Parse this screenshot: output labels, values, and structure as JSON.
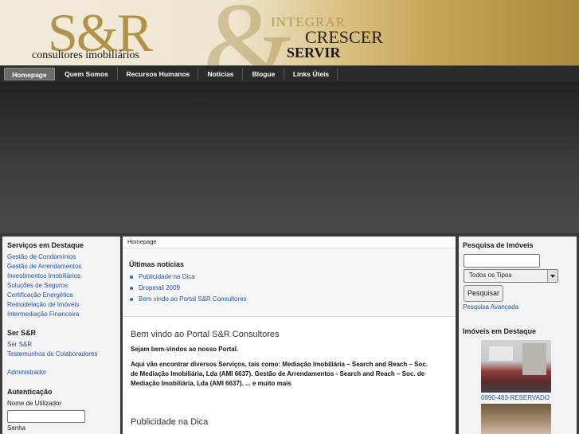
{
  "header": {
    "logo_initials": "S&R",
    "logo_subtitle": "consultores imobiliários",
    "slogan": [
      "INTEGRAR",
      "CRESCER",
      "SERVIR"
    ]
  },
  "nav": [
    "Homepage",
    "Quem Somos",
    "Recursos Humanos",
    "Notícias",
    "Blogue",
    "Links Úteis"
  ],
  "left": {
    "servicos_title": "Serviços em Destaque",
    "servicos": [
      "Gestão de Condomínios",
      "Gestão de Arrendamentos",
      "Investimentos Imobiliários",
      "Soluções de Seguros",
      "Certificação Energética",
      "Remodelação de Imóveis",
      "Intermediação Financeira"
    ],
    "ser_title": "Ser S&R",
    "ser_links": [
      "Ser S&R",
      "Testemunhos de Colaboradores"
    ],
    "admin": "Administrador",
    "auth_title": "Autenticação",
    "user_label": "Nome de Utilizador",
    "pass_label": "Senha"
  },
  "main": {
    "breadcrumb": "Homepage",
    "news_title": "Últimas notícias",
    "news": [
      "Publicidade na Dica",
      "Dropmail 2009",
      "Bem vindo ao Portal S&R Consultores"
    ],
    "article_title": "Bem vindo ao Portal S&R Consultores",
    "article_lead": "Sejam bem-vindos ao nosso Portal.",
    "article_body": [
      "Aqui vão encontrar diversos Serviços, tais como: Mediação Imobiliária – Search and Reach – Soc.",
      "de Mediação Imobiliária, Lda (AMI 6637). Gestão de Arrendamentos - Search and Reach – Soc. de",
      "Mediação Imobiliária, Lda (AMI 6637). ... e muito mais"
    ],
    "article2_title": "Publicidade na Dica"
  },
  "right": {
    "search_title": "Pesquisa de Imóveis",
    "search_value": "",
    "type_selected": "Todos os Tipos",
    "search_button": "Pesquisar",
    "advanced_link": "Pesquisa Avançada",
    "featured_title": "Imóveis em Destaque",
    "featured_ref": "0890-483-RESERVADO"
  }
}
